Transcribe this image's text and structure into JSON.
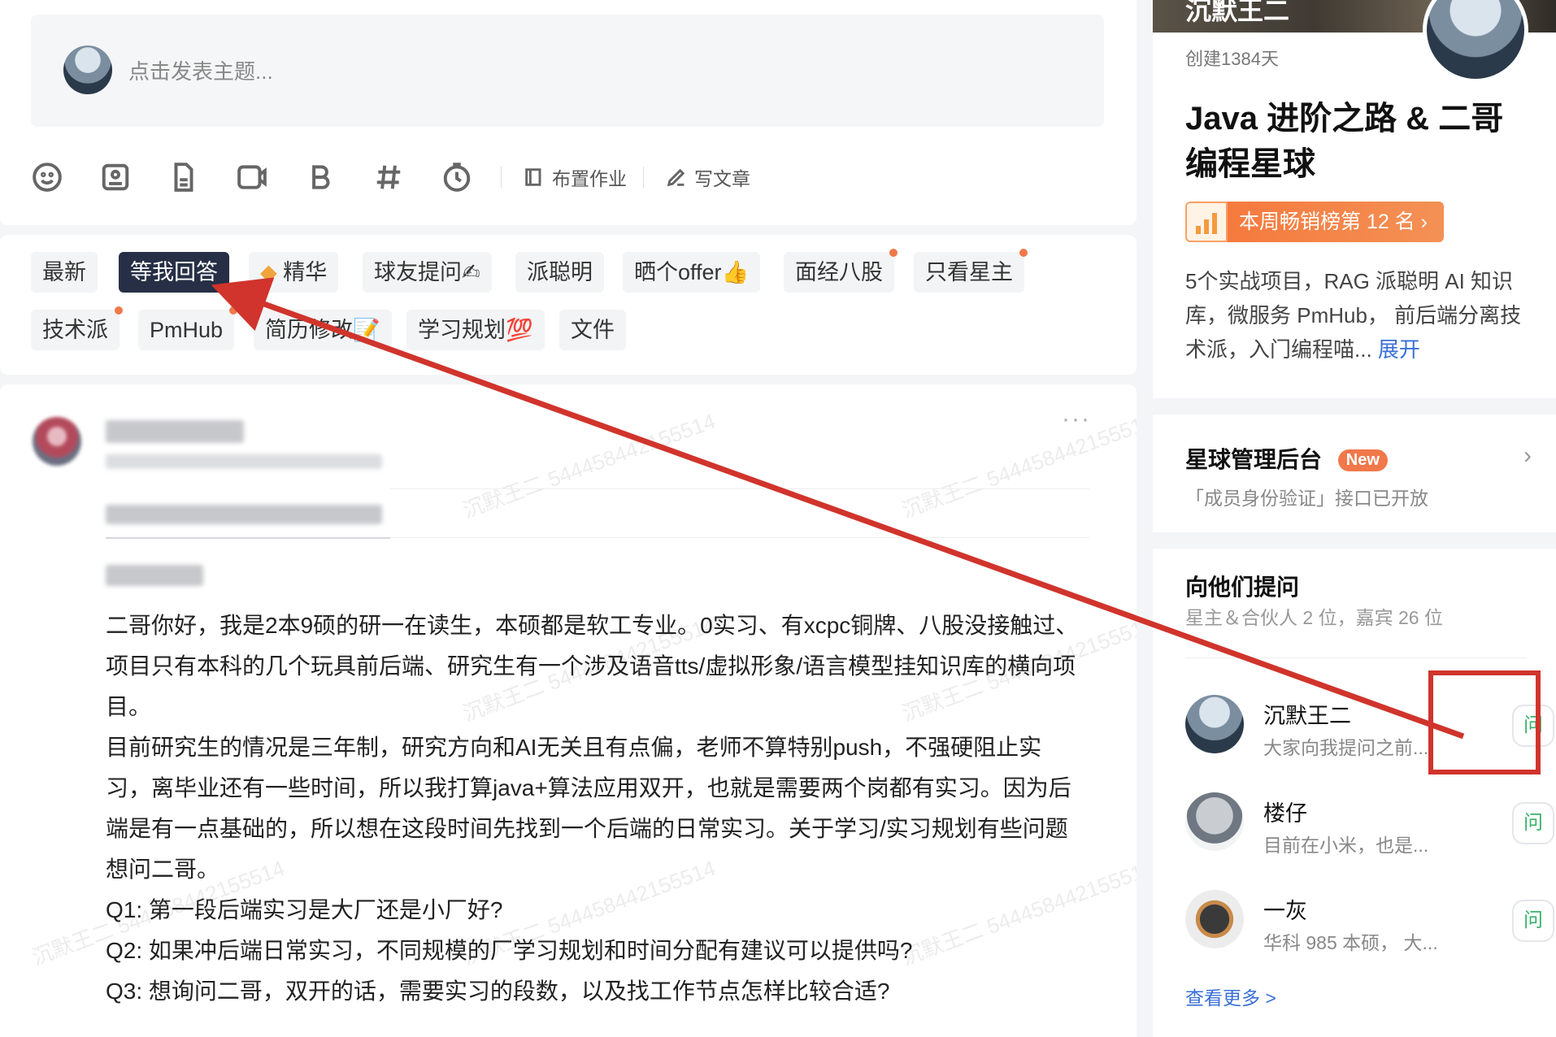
{
  "composer": {
    "placeholder": "点击发表主题...",
    "toolbar": {
      "assign_homework": "布置作业",
      "write_article": "写文章"
    }
  },
  "tabs": [
    {
      "label": "最新",
      "dot": false
    },
    {
      "label": "等我回答",
      "dot": false,
      "active": true
    },
    {
      "label": "精华",
      "dot": false
    },
    {
      "label": "球友提问✍",
      "dot": false
    },
    {
      "label": "派聪明",
      "dot": false
    },
    {
      "label": "晒个offer👍",
      "dot": false
    },
    {
      "label": "面经八股",
      "dot": true
    },
    {
      "label": "只看星主",
      "dot": true
    },
    {
      "label": "技术派",
      "dot": true
    },
    {
      "label": "PmHub",
      "dot": true
    },
    {
      "label": "简历修改📝",
      "dot": false
    },
    {
      "label": "学习规划💯",
      "dot": false
    },
    {
      "label": "文件",
      "dot": false
    }
  ],
  "post": {
    "paragraphs": [
      "二哥你好，我是2本9硕的研一在读生，本硕都是软工专业。0实习、有xcpc铜牌、八股没接触过、项目只有本科的几个玩具前后端、研究生有一个涉及语音tts/虚拟形象/语言模型挂知识库的横向项目。",
      "目前研究生的情况是三年制，研究方向和AI无关且有点偏，老师不算特别push，不强硬阻止实习，离毕业还有一些时间，所以我打算java+算法应用双开，也就是需要两个岗都有实习。因为后端是有一点基础的，所以想在这段时间先找到一个后端的日常实习。关于学习/实习规划有些问题想问二哥。"
    ],
    "questions": [
      "Q1: 第一段后端实习是大厂还是小厂好?",
      "Q2: 如果冲后端日常实习，不同规模的厂学习规划和时间分配有建议可以提供吗?",
      "Q3: 想询问二哥，双开的话，需要实习的段数，以及找工作节点怎样比较合适?"
    ],
    "watermark": "沉默王二 544458442155514"
  },
  "planet": {
    "cover_name": "沉默王二",
    "created": "创建1384天",
    "title": "Java 进阶之路 & 二哥编程星球",
    "rank": "本周畅销榜第 12 名 ›",
    "description": "5个实战项目，RAG 派聪明 AI 知识库，微服务 PmHub， 前后端分离技术派，入门编程喵...",
    "expand": "展开"
  },
  "admin": {
    "title": "星球管理后台",
    "badge": "New",
    "subtitle": "「成员身份验证」接口已开放"
  },
  "ask": {
    "title": "向他们提问",
    "subtitle": "星主＆合伙人 2 位，嘉宾 26 位",
    "members": [
      {
        "name": "沉默王二",
        "desc": "大家向我提问之前...",
        "button": "问"
      },
      {
        "name": "楼仔",
        "desc": "目前在小米，也是...",
        "button": "问"
      },
      {
        "name": "一灰",
        "desc": "华科 985 本硕， 大...",
        "button": "问"
      }
    ],
    "see_more": "查看更多 >"
  },
  "colors": {
    "active_tab": "#262f45",
    "accent_orange": "#f0784a",
    "link_blue": "#3a6fd8",
    "ask_green": "#38b36a",
    "annotation_red": "#d0342c"
  }
}
